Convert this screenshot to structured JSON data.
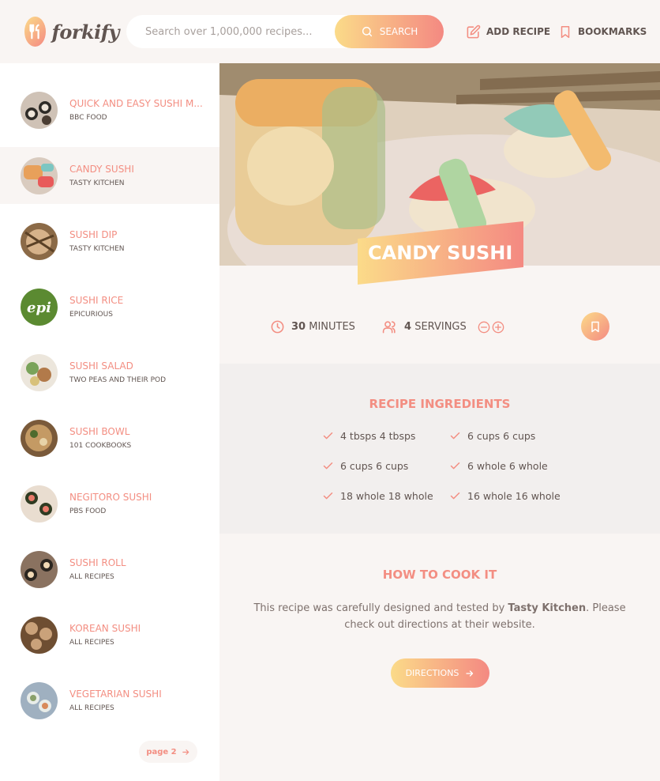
{
  "app": {
    "name": "forkify"
  },
  "search": {
    "placeholder": "Search over 1,000,000 recipes...",
    "button_label": "SEARCH"
  },
  "nav": {
    "add_recipe": "ADD RECIPE",
    "bookmarks": "BOOKMARKS"
  },
  "results": [
    {
      "title": "QUICK AND EASY SUSHI M...",
      "publisher": "BBC FOOD",
      "active": false
    },
    {
      "title": "CANDY SUSHI",
      "publisher": "TASTY KITCHEN",
      "active": true
    },
    {
      "title": "SUSHI DIP",
      "publisher": "TASTY KITCHEN",
      "active": false
    },
    {
      "title": "SUSHI RICE",
      "publisher": "EPICURIOUS",
      "active": false
    },
    {
      "title": "SUSHI SALAD",
      "publisher": "TWO PEAS AND THEIR POD",
      "active": false
    },
    {
      "title": "SUSHI BOWL",
      "publisher": "101 COOKBOOKS",
      "active": false
    },
    {
      "title": "NEGITORO SUSHI",
      "publisher": "PBS FOOD",
      "active": false
    },
    {
      "title": "SUSHI ROLL",
      "publisher": "ALL RECIPES",
      "active": false
    },
    {
      "title": "KOREAN SUSHI",
      "publisher": "ALL RECIPES",
      "active": false
    },
    {
      "title": "VEGETARIAN SUSHI",
      "publisher": "ALL RECIPES",
      "active": false
    }
  ],
  "pagination": {
    "next_label": "page 2"
  },
  "recipe": {
    "title": "CANDY SUSHI",
    "minutes": "30",
    "minutes_label": "MINUTES",
    "servings": "4",
    "servings_label": "SERVINGS"
  },
  "ingredients": {
    "title": "RECIPE INGREDIENTS",
    "items": [
      "4 tbsps 4 tbsps",
      "6 cups 6 cups",
      "6 cups 6 cups",
      "6 whole 6 whole",
      "18 whole 18 whole",
      "16 whole 16 whole"
    ]
  },
  "cook": {
    "title": "HOW TO COOK IT",
    "text_before": "This recipe was carefully designed and tested by ",
    "publisher": "Tasty Kitchen",
    "text_after": ". Please check out directions at their website.",
    "button_label": "DIRECTIONS"
  },
  "colors": {
    "accent": "#f38e82",
    "gradient_start": "#fbdb89",
    "gradient_end": "#f48982",
    "text": "#615551",
    "background": "#f9f5f3"
  },
  "icons": {
    "search_button": "search-icon",
    "add_recipe": "edit-icon",
    "bookmarks": "bookmark-icon",
    "time": "clock-icon",
    "servings": "users-icon",
    "decrease": "minus-circle-icon",
    "increase": "plus-circle-icon",
    "ingredient": "check-icon",
    "arrow": "arrow-right-icon"
  }
}
